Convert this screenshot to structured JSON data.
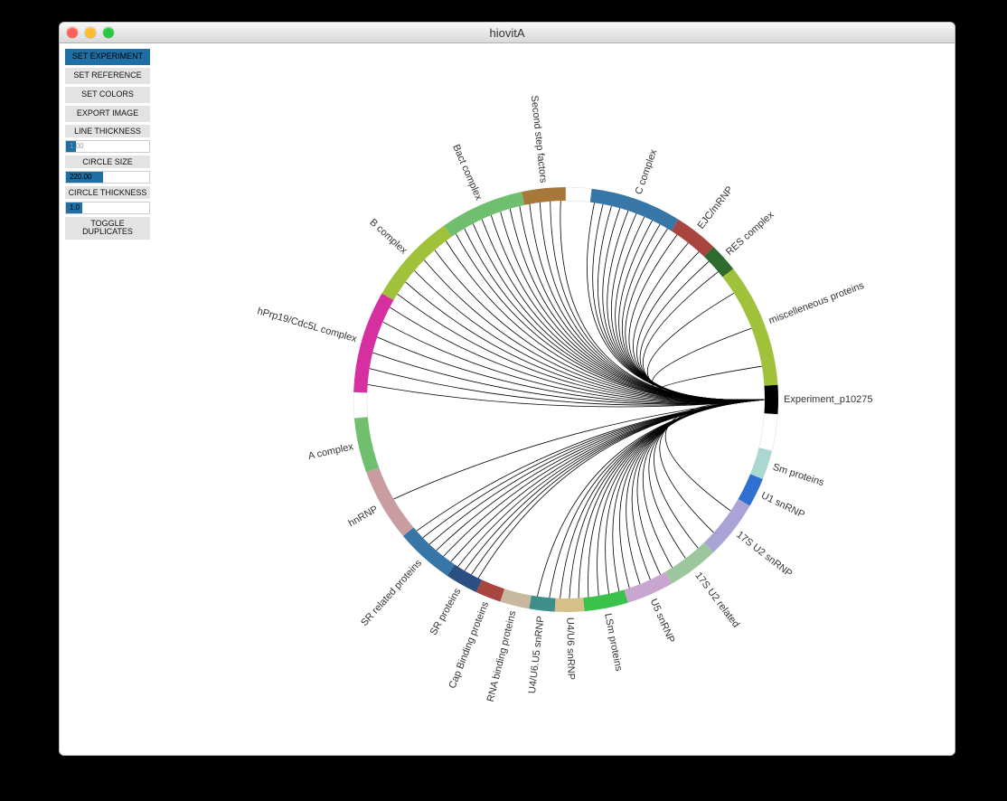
{
  "window": {
    "title": "hiovitA"
  },
  "sidebar": {
    "set_experiment": "SET EXPERIMENT",
    "set_reference": "SET REFERENCE",
    "set_colors": "SET COLORS",
    "export_image": "EXPORT IMAGE",
    "line_thickness_label": "LINE THICKNESS",
    "line_thickness_value": "1.00",
    "circle_size_label": "CIRCLE SIZE",
    "circle_size_value": "220.00",
    "circle_thickness_label": "CIRCLE THICKNESS",
    "circle_thickness_value": "1.0",
    "toggle_duplicates": "TOGGLE DUPLICATES"
  },
  "chart_data": {
    "type": "chord",
    "radius": 220,
    "ring_thickness": 15,
    "segments": [
      {
        "id": "experiment",
        "label": "Experiment_p10275",
        "start": -4,
        "end": 4,
        "color": "#000000",
        "label_color": "#000"
      },
      {
        "id": "gap1",
        "label": "",
        "start": 4,
        "end": 14,
        "color": "#ffffff",
        "label_color": "#000"
      },
      {
        "id": "sm",
        "label": "Sm proteins",
        "start": 14,
        "end": 22,
        "color": "#a8d8cf",
        "label_color": "#9cc7bf"
      },
      {
        "id": "u1",
        "label": "U1 snRNP",
        "start": 22,
        "end": 30,
        "color": "#2f6fd0",
        "label_color": "#2f6fd0"
      },
      {
        "id": "u2_17s",
        "label": "17S U2 snRNP",
        "start": 30,
        "end": 46,
        "color": "#a9a3d6",
        "label_color": "#8f88c7"
      },
      {
        "id": "u2_rel",
        "label": "17S U2 related",
        "start": 46,
        "end": 60,
        "color": "#9cc79c",
        "label_color": "#7faa7f"
      },
      {
        "id": "u5",
        "label": "U5 snRNP",
        "start": 60,
        "end": 73,
        "color": "#c9a6cf",
        "label_color": "#b38cba"
      },
      {
        "id": "lsm",
        "label": "LSm proteins",
        "start": 73,
        "end": 85,
        "color": "#3bc24a",
        "label_color": "#2f9c3b"
      },
      {
        "id": "u4u6",
        "label": "U4/U6 snRNP",
        "start": 85,
        "end": 93,
        "color": "#d6c08a",
        "label_color": "#b8a26c"
      },
      {
        "id": "u4u6u5",
        "label": "U4/U6.U5 snRNP",
        "start": 93,
        "end": 100,
        "color": "#3e8f8a",
        "label_color": "#3e8f8a"
      },
      {
        "id": "rnabind",
        "label": "RNA binding proteins",
        "start": 100,
        "end": 108,
        "color": "#c9b8a0",
        "label_color": "#b0a288"
      },
      {
        "id": "cap",
        "label": "Cap Binding proteins",
        "start": 108,
        "end": 115,
        "color": "#a8453f",
        "label_color": "#7a312c"
      },
      {
        "id": "sr",
        "label": "SR proteins",
        "start": 115,
        "end": 124,
        "color": "#2c4f82",
        "label_color": "#1e3a63"
      },
      {
        "id": "sr_rel",
        "label": "SR related proteins",
        "start": 124,
        "end": 140,
        "color": "#3876a8",
        "label_color": "#7a96ad"
      },
      {
        "id": "hnrnp",
        "label": "hnRNP",
        "start": 140,
        "end": 160,
        "color": "#c99ca0",
        "label_color": "#b38a8e"
      },
      {
        "id": "a_complex",
        "label": "A complex",
        "start": 160,
        "end": 175,
        "color": "#6fbf6f",
        "label_color": "#5aa85a"
      },
      {
        "id": "gap2",
        "label": "",
        "start": 175,
        "end": 182,
        "color": "#ffffff",
        "label_color": "#000"
      },
      {
        "id": "hprp19",
        "label": "hPrp19/Cdc5L complex",
        "start": 182,
        "end": 210,
        "color": "#d62fa0",
        "label_color": "#c22890"
      },
      {
        "id": "b_complex",
        "label": "B complex",
        "start": 210,
        "end": 235,
        "color": "#a0c23b",
        "label_color": "#8aa832"
      },
      {
        "id": "bact",
        "label": "Bact complex",
        "start": 235,
        "end": 258,
        "color": "#6fbf6f",
        "label_color": "#5aa85a"
      },
      {
        "id": "secondstep",
        "label": "Second step factors",
        "start": 258,
        "end": 270,
        "color": "#a8783b",
        "label_color": "#8a6230"
      },
      {
        "id": "gap3",
        "label": "",
        "start": 270,
        "end": 277,
        "color": "#ffffff",
        "label_color": "#000"
      },
      {
        "id": "c_complex",
        "label": "C complex",
        "start": 277,
        "end": 302,
        "color": "#3876a8",
        "label_color": "#2c5a82"
      },
      {
        "id": "ejc",
        "label": "EJC/mRNP",
        "start": 302,
        "end": 314,
        "color": "#a8453f",
        "label_color": "#7a312c"
      },
      {
        "id": "res",
        "label": "RES complex",
        "start": 314,
        "end": 322,
        "color": "#2f6b2f",
        "label_color": "#244f24"
      },
      {
        "id": "misc",
        "label": "miscelleneous proteins",
        "start": 322,
        "end": 356,
        "color": "#a0c23b",
        "label_color": "#8aa832"
      }
    ],
    "chords_from": "experiment",
    "chords_to": [
      {
        "seg": "u4u6u5",
        "n": 2
      },
      {
        "seg": "u4u6",
        "n": 3
      },
      {
        "seg": "lsm",
        "n": 4
      },
      {
        "seg": "u5",
        "n": 4
      },
      {
        "seg": "u2_rel",
        "n": 3
      },
      {
        "seg": "u2_17s",
        "n": 2
      },
      {
        "seg": "sr",
        "n": 4
      },
      {
        "seg": "sr_rel",
        "n": 6
      },
      {
        "seg": "hnrnp",
        "n": 1
      },
      {
        "seg": "hprp19",
        "n": 6
      },
      {
        "seg": "b_complex",
        "n": 6
      },
      {
        "seg": "bact",
        "n": 8
      },
      {
        "seg": "secondstep",
        "n": 4
      },
      {
        "seg": "c_complex",
        "n": 10
      },
      {
        "seg": "ejc",
        "n": 3
      },
      {
        "seg": "res",
        "n": 2
      },
      {
        "seg": "misc",
        "n": 3
      }
    ]
  }
}
